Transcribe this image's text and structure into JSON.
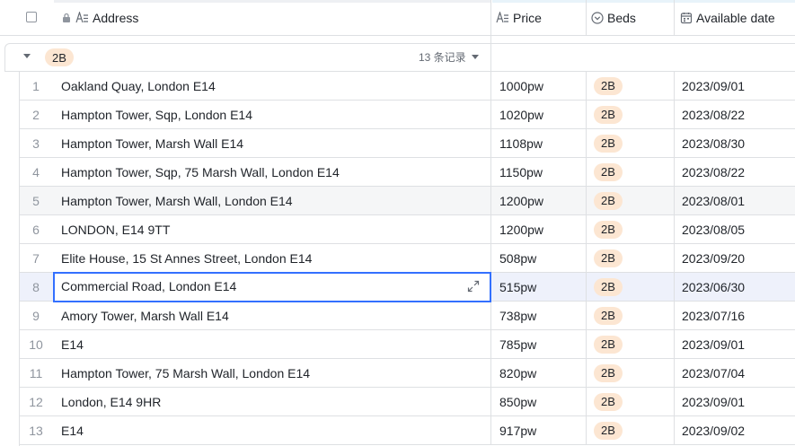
{
  "header": {
    "address_label": "Address",
    "price_label": "Price",
    "beds_label": "Beds",
    "date_label": "Available date"
  },
  "group": {
    "tag": "2B",
    "count": "13 条记录"
  },
  "rows": [
    {
      "num": "1",
      "address": "Oakland Quay, London E14",
      "price": "1000pw",
      "beds": "2B",
      "date": "2023/09/01"
    },
    {
      "num": "2",
      "address": "Hampton Tower, Sqp, London E14",
      "price": "1020pw",
      "beds": "2B",
      "date": "2023/08/22"
    },
    {
      "num": "3",
      "address": "Hampton Tower, Marsh Wall E14",
      "price": "1108pw",
      "beds": "2B",
      "date": "2023/08/30"
    },
    {
      "num": "4",
      "address": "Hampton Tower, Sqp, 75 Marsh Wall, London E14",
      "price": "1150pw",
      "beds": "2B",
      "date": "2023/08/22"
    },
    {
      "num": "5",
      "address": "Hampton Tower, Marsh Wall, London E14",
      "price": "1200pw",
      "beds": "2B",
      "date": "2023/08/01"
    },
    {
      "num": "6",
      "address": "LONDON, E14 9TT",
      "price": "1200pw",
      "beds": "2B",
      "date": "2023/08/05"
    },
    {
      "num": "7",
      "address": "Elite House, 15 St Annes Street, London E14",
      "price": "508pw",
      "beds": "2B",
      "date": "2023/09/20"
    },
    {
      "num": "8",
      "address": "Commercial Road, London E14",
      "price": "515pw",
      "beds": "2B",
      "date": "2023/06/30"
    },
    {
      "num": "9",
      "address": "Amory Tower, Marsh Wall E14",
      "price": "738pw",
      "beds": "2B",
      "date": "2023/07/16"
    },
    {
      "num": "10",
      "address": "E14",
      "price": "785pw",
      "beds": "2B",
      "date": "2023/09/01"
    },
    {
      "num": "11",
      "address": "Hampton Tower, 75 Marsh Wall, London E14",
      "price": "820pw",
      "beds": "2B",
      "date": "2023/07/04"
    },
    {
      "num": "12",
      "address": "London, E14 9HR",
      "price": "850pw",
      "beds": "2B",
      "date": "2023/09/01"
    },
    {
      "num": "13",
      "address": "E14",
      "price": "917pw",
      "beds": "2B",
      "date": "2023/09/02"
    }
  ],
  "colors": {
    "tag_bg": "#fce6d2",
    "selection_border": "#3370ff",
    "selected_row_bg": "#eef1fb",
    "hover_row_bg": "#f5f6f7"
  },
  "icons": {
    "lock": "lock-icon",
    "text_field": "text-field-icon",
    "single_select": "single-select-icon",
    "date": "calendar-icon",
    "expand": "expand-icon"
  }
}
